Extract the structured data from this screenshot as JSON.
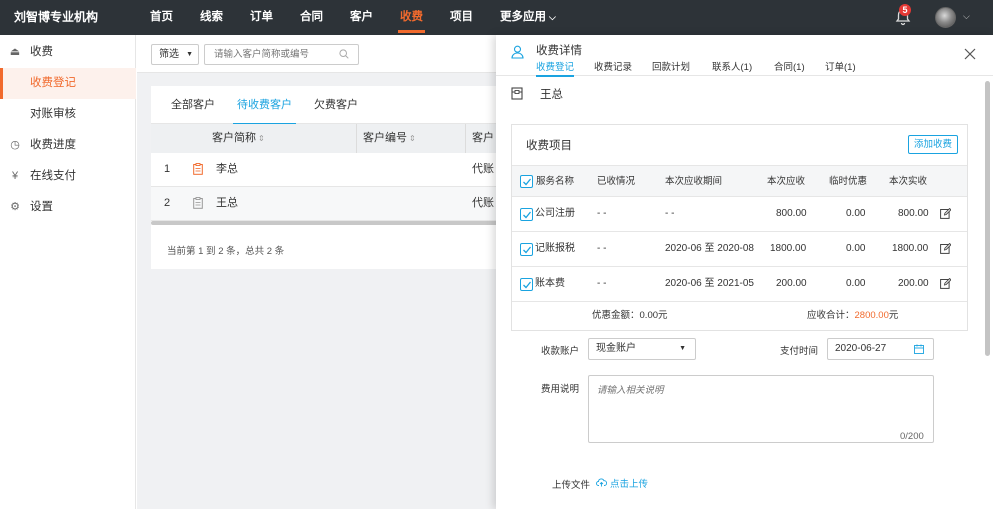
{
  "brand": "刘智博专业机构",
  "nav": [
    "首页",
    "线索",
    "订单",
    "合同",
    "客户",
    "收费",
    "项目",
    "更多应用"
  ],
  "notification_count": "5",
  "sidebar": {
    "items": [
      {
        "label": "收费",
        "icon": "cash-icon"
      },
      {
        "label": "收费登记"
      },
      {
        "label": "对账审核"
      },
      {
        "label": "收费进度",
        "icon": "progress-icon"
      },
      {
        "label": "在线支付",
        "icon": "yuan-icon"
      },
      {
        "label": "设置",
        "icon": "gear-icon"
      }
    ]
  },
  "filter": {
    "select_label": "筛选",
    "search_placeholder": "请输入客户简称或编号"
  },
  "customer_tabs": [
    "全部客户",
    "待收费客户",
    "欠费客户"
  ],
  "table": {
    "headers": [
      "客户简称",
      "客户编号",
      "客户"
    ],
    "rows": [
      {
        "index": "1",
        "name": "李总",
        "code": "",
        "type": "代账"
      },
      {
        "index": "2",
        "name": "王总",
        "code": "",
        "type": "代账"
      }
    ],
    "page_info": "当前第 1 到 2 条，总共 2 条"
  },
  "detail": {
    "title": "收费详情",
    "tabs": [
      "收费登记",
      "收费记录",
      "回款计划",
      "联系人(1)",
      "合同(1)",
      "订单(1)"
    ],
    "client_name": "王总",
    "fee_items_title": "收费项目",
    "add_button": "添加收费",
    "fee_headers": [
      "服务名称",
      "已收情况",
      "本次应收期间",
      "本次应收",
      "临时优惠",
      "本次实收"
    ],
    "fee_rows": [
      {
        "name": "公司注册",
        "received": "- -",
        "period": "- -",
        "due": "800.00",
        "discount": "0.00",
        "actual": "800.00"
      },
      {
        "name": "记账报税",
        "received": "- -",
        "period": "2020-06 至 2020-08",
        "due": "1800.00",
        "discount": "0.00",
        "actual": "1800.00"
      },
      {
        "name": "账本费",
        "received": "- -",
        "period": "2020-06 至 2021-05",
        "due": "200.00",
        "discount": "0.00",
        "actual": "200.00"
      }
    ],
    "discount_label": "优惠金额：",
    "discount_value": "0.00元",
    "total_label": "应收合计：",
    "total_value": "2800.00",
    "total_unit": "元",
    "account_label": "收款账户",
    "account_value": "现金账户",
    "pay_time_label": "支付时间",
    "pay_time_value": "2020-06-27",
    "note_label": "费用说明",
    "note_placeholder": "请输入相关说明",
    "note_counter": "0/200",
    "upload_label": "上传文件",
    "upload_link": "点击上传"
  },
  "colors": {
    "accent": "#f16a2d",
    "link": "#1aa3e0",
    "topbar": "#2d3338"
  }
}
